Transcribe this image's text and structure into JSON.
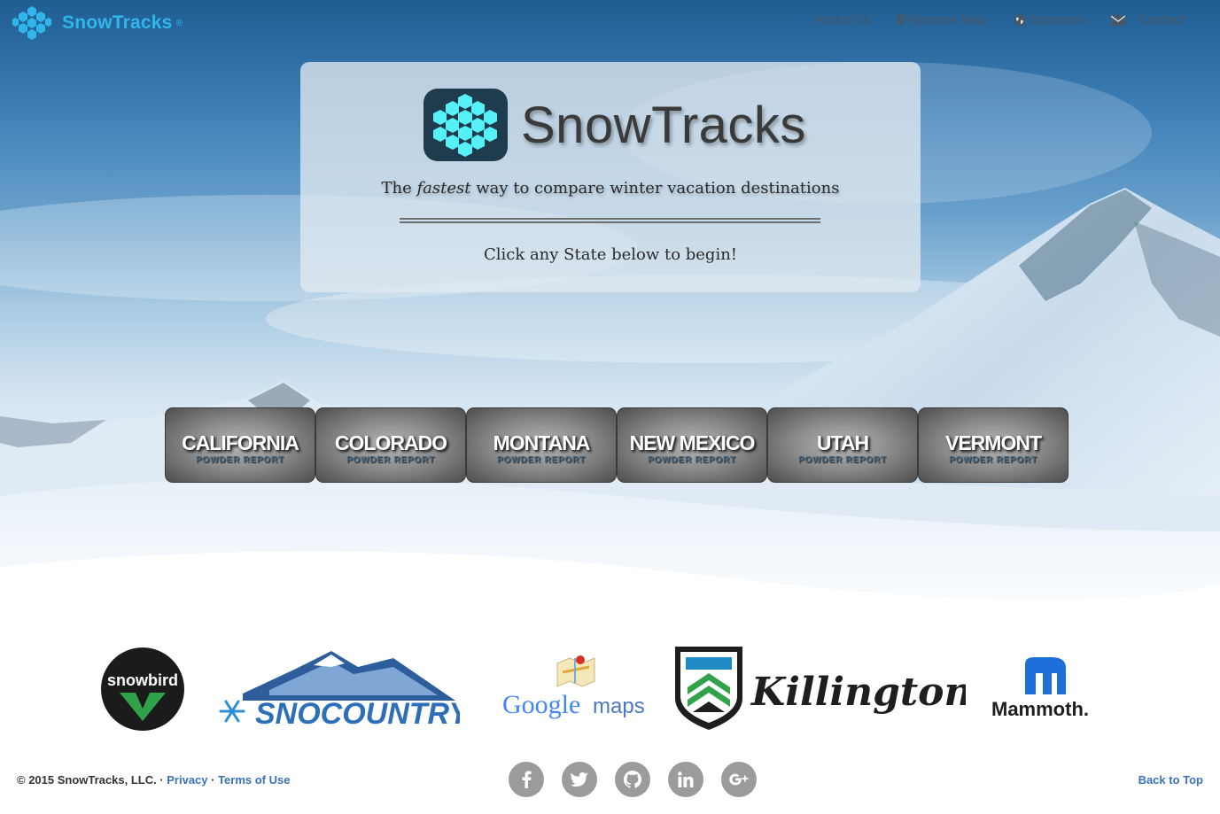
{
  "navbar": {
    "brand": "SnowTracks",
    "registered": "®",
    "links": [
      {
        "label": "About Us",
        "icon": "none"
      },
      {
        "label": "Remove Map",
        "icon": "map-marker-icon"
      },
      {
        "label": "Sponsors",
        "icon": "globe-icon"
      },
      {
        "label": "Contact",
        "icon": "envelope-icon"
      }
    ]
  },
  "hero": {
    "title": "SnowTracks",
    "tagline_prefix": "The ",
    "tagline_emphasis": "fastest",
    "tagline_suffix": " way to compare winter vacation destinations",
    "prompt": "Click any State below to begin!"
  },
  "states": [
    {
      "name": "CALIFORNIA",
      "sub": "POWDER REPORT"
    },
    {
      "name": "COLORADO",
      "sub": "POWDER REPORT"
    },
    {
      "name": "MONTANA",
      "sub": "POWDER REPORT"
    },
    {
      "name": "NEW MEXICO",
      "sub": "POWDER REPORT"
    },
    {
      "name": "UTAH",
      "sub": "POWDER REPORT"
    },
    {
      "name": "VERMONT",
      "sub": "POWDER REPORT"
    }
  ],
  "sponsors": {
    "snowbird": "snowbird",
    "snocountry": "SNOCOUNTRY",
    "google_g": "Google",
    "google_maps": "maps",
    "killington": "Killington",
    "mammoth": "Mammoth."
  },
  "footer": {
    "copyright": "© 2015 SnowTracks, LLC. · ",
    "privacy": "Privacy",
    "sep": " · ",
    "terms": "Terms of Use",
    "back_to_top": "Back to Top",
    "social": [
      "facebook-icon",
      "twitter-icon",
      "github-icon",
      "linkedin-icon",
      "google-plus-icon"
    ]
  },
  "colors": {
    "brand": "#2fb7ec",
    "link": "#3a72b8",
    "logo_cyan": "#56f0f7",
    "logo_dark": "#1e3c4e"
  }
}
